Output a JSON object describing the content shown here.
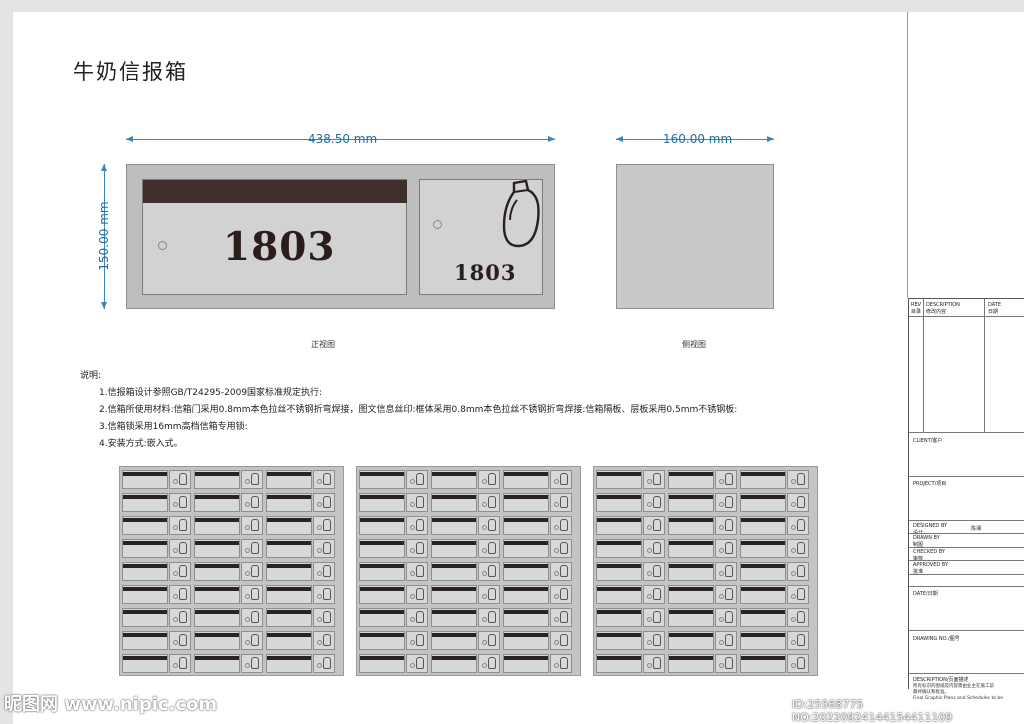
{
  "title": "牛奶信报箱",
  "dimensions": {
    "front_width": "438.50 mm",
    "front_height": "150.00 mm",
    "side_width": "160.00 mm"
  },
  "mailbox": {
    "number_large": "1803",
    "number_small": "1803"
  },
  "captions": {
    "front": "正视图",
    "side": "侧视图"
  },
  "notes": {
    "heading": "说明:",
    "items": [
      "1.信报箱设计参照GB/T24295-2009国家标准规定执行:",
      "2.信箱所使用材料:信箱门采用0.8mm本色拉丝不锈钢折弯焊接，图文信息丝印:框体采用0.8mm本色拉丝不锈钢折弯焊接:信箱隔板、层板采用0.5mm不锈钢板:",
      "3.信箱锁采用16mm高档信箱专用锁:",
      "4.安装方式:嵌入式。"
    ]
  },
  "title_block": {
    "rev": "REV",
    "rev_cn": "目录",
    "description": "DESCRIPTION",
    "description_cn": "修改内容",
    "date": "DATE",
    "date_cn": "日期",
    "client": "CLIENT/客户",
    "project": "PROJECT/项目",
    "designed_by": "DESIGNED BY",
    "designed_by_cn": "设计",
    "designer_name": "陈湘",
    "drawn_by": "DRAWN BY",
    "drawn_by_cn": "制图",
    "checked_by": "CHECKED BY",
    "checked_by_cn": "审核",
    "approved_by": "APPROVED BY",
    "approved_by_cn": "批准",
    "date_label": "DATE/日期",
    "drawing_no": "DRAWING NO./图号",
    "desc_label": "DESCRIPTION/页面描述",
    "note_cn": "所有标识的图纸及内容需由业主在施工前",
    "note_cn2": "最终确认和批准。",
    "note_en": "Final Graphic Plans and Schedules to be"
  },
  "watermark": {
    "left": "昵图网 www.nipic.com",
    "right": "ID:25568775 NO:20220924144154411109"
  }
}
